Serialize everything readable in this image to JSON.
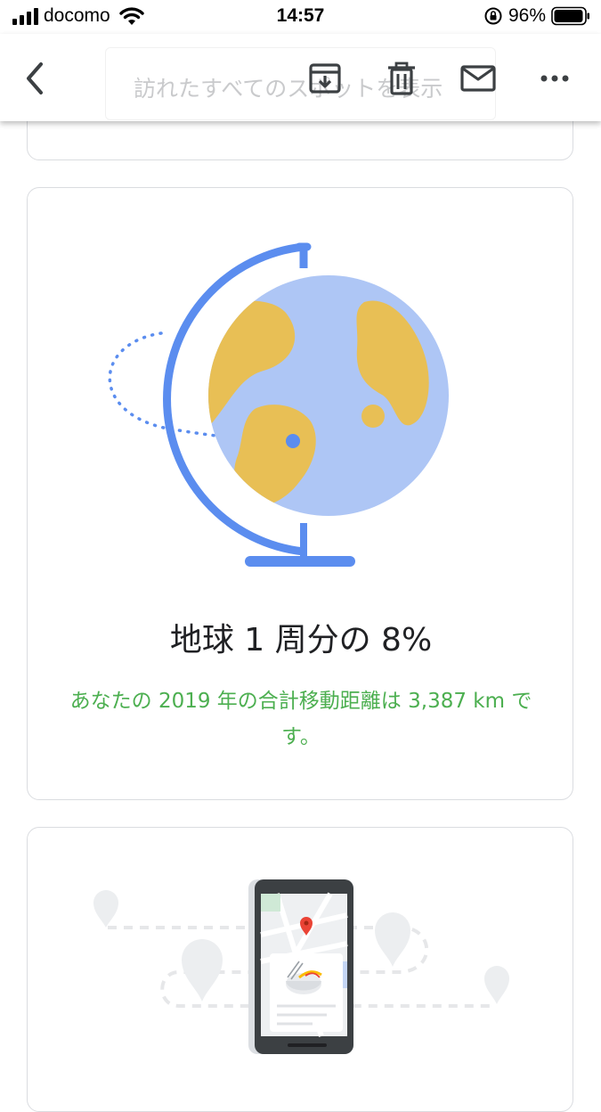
{
  "status_bar": {
    "carrier": "docomo",
    "time": "14:57",
    "battery_percent": "96%"
  },
  "toolbar": {
    "ghost_text": "訪れたすべてのスポットを表示",
    "icons": [
      "back-icon",
      "archive-icon",
      "trash-icon",
      "mail-icon",
      "more-icon"
    ]
  },
  "globe_card": {
    "headline": "地球 1 周分の 8%",
    "subtext": "あなたの 2019 年の合計移動距離は 3,387 km です。"
  },
  "colors": {
    "accent_blue": "#5b8def",
    "globe_blue": "#aec6f5",
    "land_yellow": "#e8bf55",
    "green_text": "#4caf50",
    "card_border": "#dadce0"
  }
}
